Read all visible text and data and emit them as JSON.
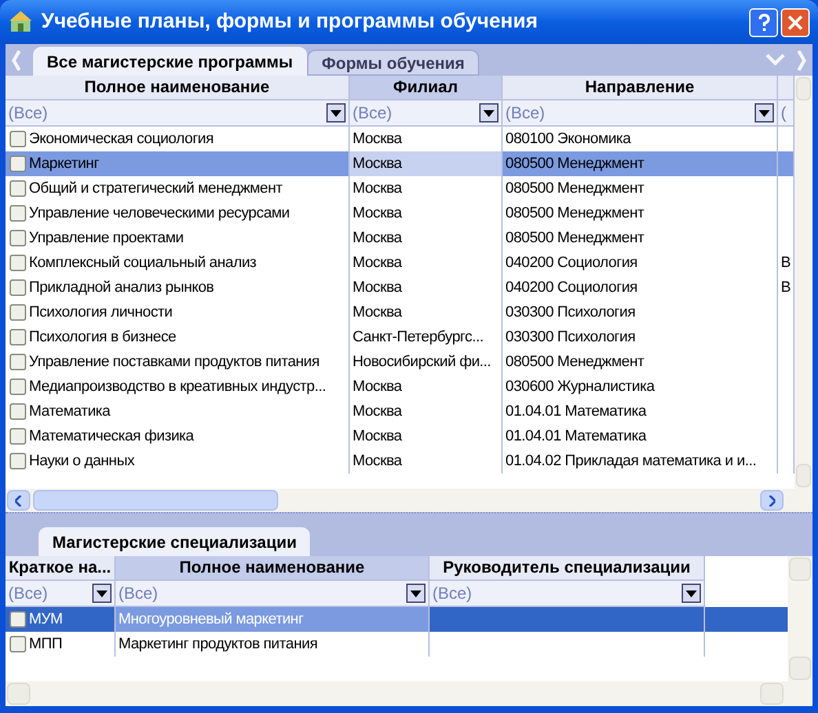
{
  "window": {
    "title": "Учебные планы, формы и программы обучения"
  },
  "tabs": [
    {
      "label": "Все магистерские программы",
      "selected": true
    },
    {
      "label": "Формы обучения",
      "selected": false
    }
  ],
  "programs": {
    "columns": [
      {
        "title": "Полное наименование",
        "filter": "(Все)",
        "active": false
      },
      {
        "title": "Филиал",
        "filter": "(Все)",
        "active": true
      },
      {
        "title": "Направление",
        "filter": "(Все)",
        "active": false
      },
      {
        "filter": "(",
        "active": false
      }
    ],
    "rows": [
      {
        "cells": [
          "Экономическая социология",
          "Москва",
          "080100 Экономика",
          ""
        ],
        "checked": false,
        "selected": false
      },
      {
        "cells": [
          "Маркетинг",
          "Москва",
          "080500 Менеджмент",
          ""
        ],
        "checked": false,
        "selected": true
      },
      {
        "cells": [
          "Общий и стратегический менеджмент",
          "Москва",
          "080500 Менеджмент",
          ""
        ],
        "checked": false,
        "selected": false
      },
      {
        "cells": [
          "Управление человеческими ресурсами",
          "Москва",
          "080500 Менеджмент",
          ""
        ],
        "checked": false,
        "selected": false
      },
      {
        "cells": [
          "Управление проектами",
          "Москва",
          "080500 Менеджмент",
          ""
        ],
        "checked": false,
        "selected": false
      },
      {
        "cells": [
          "Комплексный социальный анализ",
          "Москва",
          "040200 Социология",
          "В"
        ],
        "checked": false,
        "selected": false
      },
      {
        "cells": [
          "Прикладной анализ рынков",
          "Москва",
          "040200 Социология",
          "В"
        ],
        "checked": false,
        "selected": false
      },
      {
        "cells": [
          "Психология личности",
          "Москва",
          "030300 Психология",
          ""
        ],
        "checked": false,
        "selected": false
      },
      {
        "cells": [
          "Психология в бизнесе",
          "Санкт-Петербургс...",
          "030300 Психология",
          ""
        ],
        "checked": false,
        "selected": false
      },
      {
        "cells": [
          "Управление поставками продуктов питания",
          "Новосибирский фи...",
          "080500 Менеджмент",
          ""
        ],
        "checked": false,
        "selected": false
      },
      {
        "cells": [
          "Медиапроизводство в креативных индустр...",
          "Москва",
          "030600 Журналистика",
          ""
        ],
        "checked": false,
        "selected": false
      },
      {
        "cells": [
          "Математика",
          "Москва",
          "01.04.01 Математика",
          ""
        ],
        "checked": false,
        "selected": false
      },
      {
        "cells": [
          "Математическая физика",
          "Москва",
          "01.04.01 Математика",
          ""
        ],
        "checked": false,
        "selected": false
      },
      {
        "cells": [
          "Науки о данных",
          "Москва",
          "01.04.02 Прикладая математика и и...",
          ""
        ],
        "checked": false,
        "selected": false
      }
    ]
  },
  "bottom_tabs": [
    {
      "label": "Магистерские специализации",
      "selected": true
    }
  ],
  "specializations": {
    "columns": [
      {
        "title": "Краткое на...",
        "filter": "(Все)",
        "active": false
      },
      {
        "title": "Полное наименование",
        "filter": "(Все)",
        "active": true
      },
      {
        "title": "Руководитель специализации",
        "filter": "(Все)",
        "active": false
      }
    ],
    "rows": [
      {
        "cells": [
          "МУМ",
          "Многоуровневый маркетинг",
          ""
        ],
        "checked": false,
        "selected": true
      },
      {
        "cells": [
          "МПП",
          "Маркетинг продуктов питания",
          ""
        ],
        "checked": false,
        "selected": false
      }
    ]
  }
}
